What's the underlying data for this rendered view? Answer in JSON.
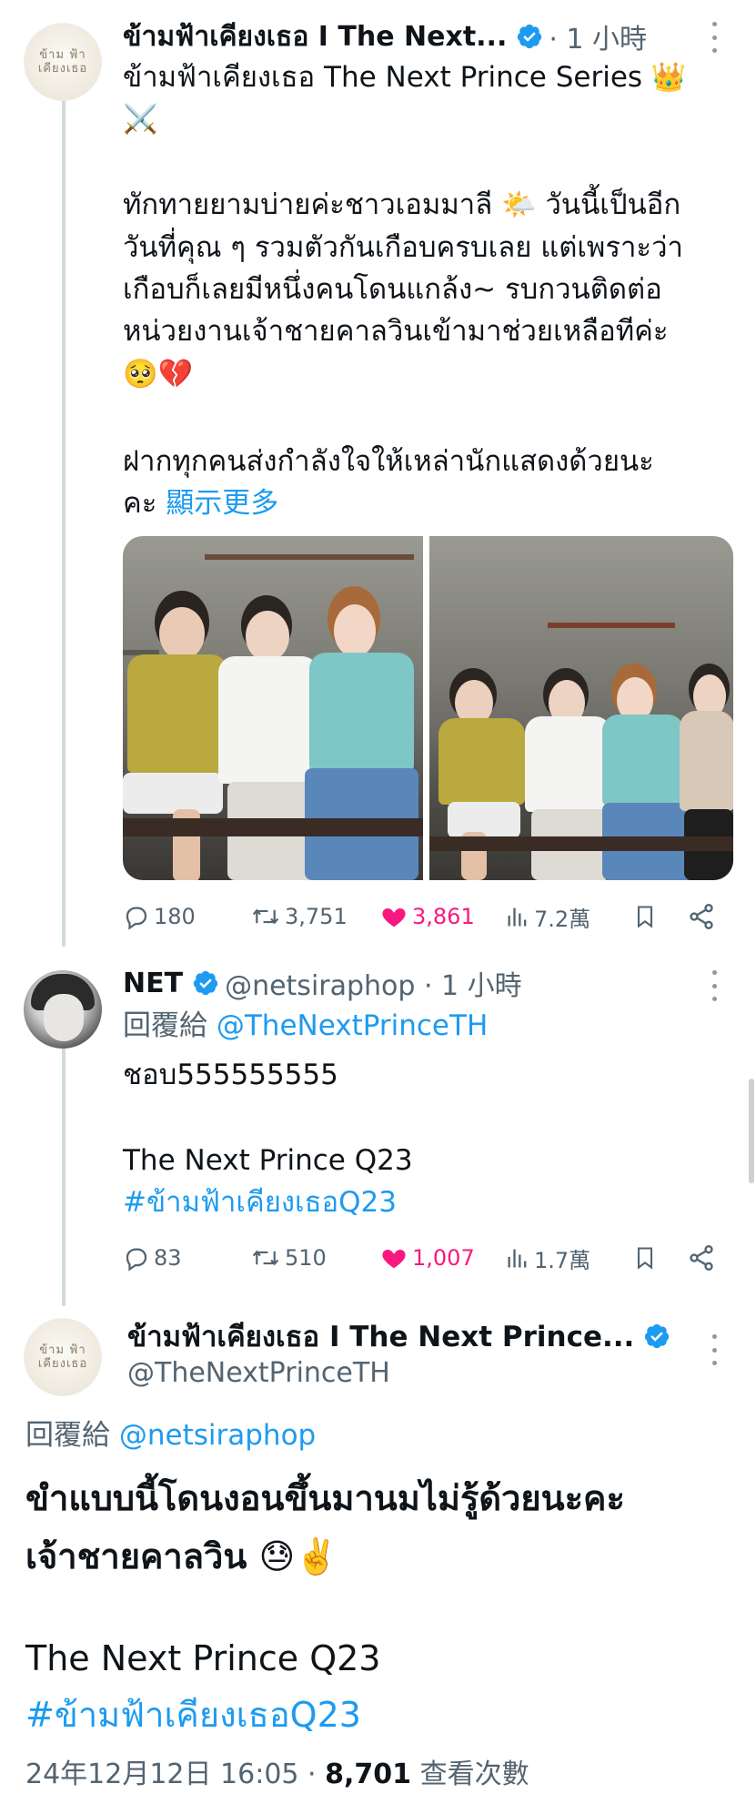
{
  "tweet1": {
    "name": "ข้ามฟ้าเคียงเธอ I The Next...",
    "time": "· 1 小時",
    "text_lines": [
      "ข้ามฟ้าเคียงเธอ The Next Prince Series 👑",
      "⚔️",
      "",
      "ทักทายยามบ่ายค่ะชาวเอมมาลี 🌤️ วันนี้เป็นอีก",
      "วันที่คุณ ๆ รวมตัวกันเกือบครบเลย แต่เพราะว่า",
      "เกือบก็เลยมีหนึ่งคนโดนแกล้ง~ รบกวนติดต่อ",
      "หน่วยงานเจ้าชายคาลวินเข้ามาช่วยเหลือทีค่ะ",
      "🥺💔",
      "",
      "ฝากทุกคนส่งกำลังใจให้เหล่านักแสดงด้วยนะ"
    ],
    "last_line": "คะ",
    "show_more": "顯示更多",
    "stats": {
      "replies": "180",
      "retweets": "3,751",
      "likes": "3,861",
      "views": "7.2萬"
    }
  },
  "tweet2": {
    "name": "NET",
    "handle_time": "@netsiraphop · 1 小時",
    "reply_prefix": "回覆給",
    "reply_to": "@TheNextPrinceTH",
    "text_lines": [
      "ชอบ555555555",
      "",
      "The Next Prince Q23"
    ],
    "hashtag": "#ข้ามฟ้าเคียงเธอQ23",
    "stats": {
      "replies": "83",
      "retweets": "510",
      "likes": "1,007",
      "views": "1.7萬"
    }
  },
  "tweet3": {
    "name": "ข้ามฟ้าเคียงเธอ I The Next Prince...",
    "handle": "@TheNextPrinceTH",
    "reply_prefix": "回覆給",
    "reply_to": "@netsiraphop",
    "text_lines": [
      "ขำแบบนี้โดนงอนขึ้นมานมไม่รู้ด้วยนะคะ",
      "เจ้าชายคาลวิน 😓✌️",
      "",
      "The Next Prince Q23"
    ],
    "hashtag": "#ข้ามฟ้าเคียงเธอQ23",
    "date": "24年12月12日 16:05 · ",
    "views_count": "8,701",
    "views_label": " 查看次數"
  },
  "logo_text": "ข้าม ฟ้า เคียงเธอ",
  "colors": {
    "link": "#1d9bf0",
    "like": "#f91880",
    "meta": "#536471",
    "thread": "#cfd9de"
  }
}
